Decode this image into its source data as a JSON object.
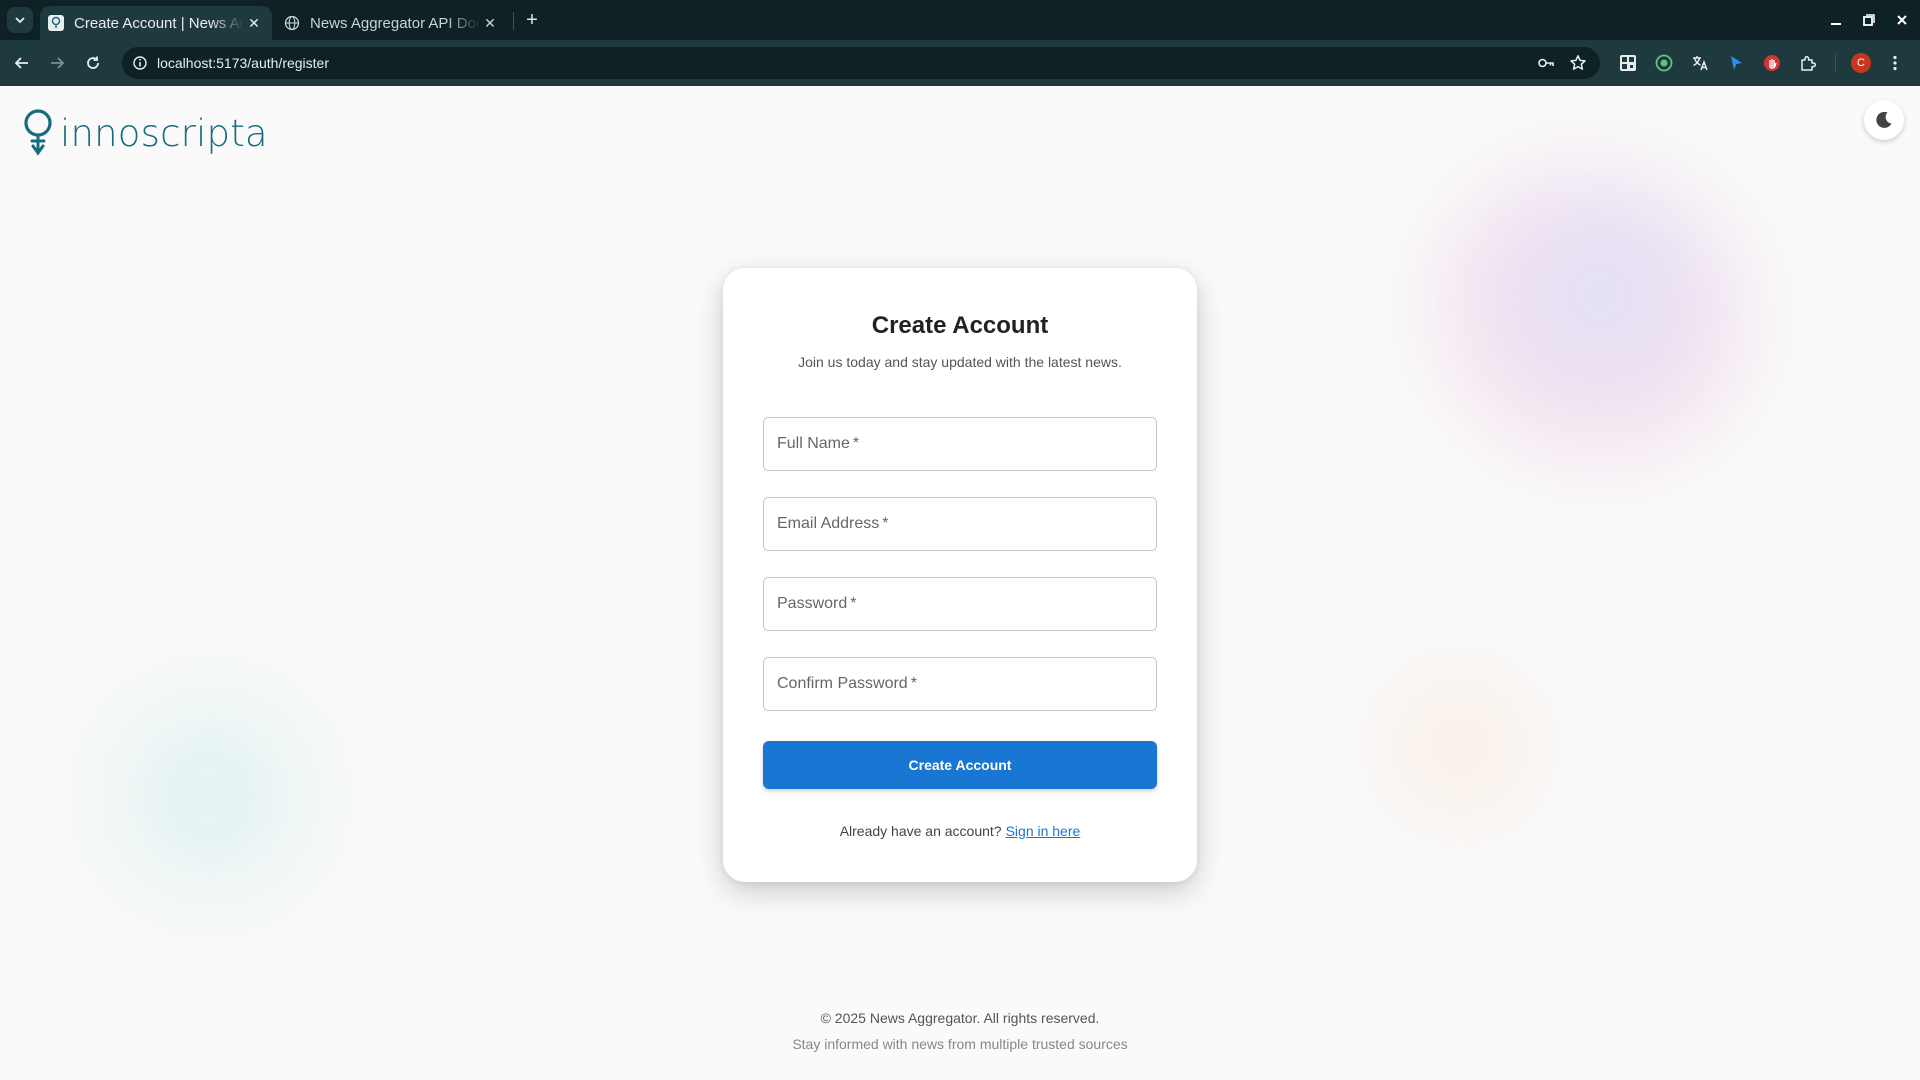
{
  "browser": {
    "tabs": [
      {
        "title": "Create Account | News Aggregator",
        "active": true
      },
      {
        "title": "News Aggregator API Docs",
        "active": false
      }
    ],
    "url": "localhost:5173/auth/register",
    "profile_initial": "C"
  },
  "page": {
    "brand": "innoscripta",
    "card": {
      "title": "Create Account",
      "subtitle": "Join us today and stay updated with the latest news.",
      "fields": [
        {
          "label": "Full Name",
          "required_mark": "*"
        },
        {
          "label": "Email Address",
          "required_mark": "*"
        },
        {
          "label": "Password",
          "required_mark": "*"
        },
        {
          "label": "Confirm Password",
          "required_mark": "*"
        }
      ],
      "submit_label": "Create Account",
      "signin_prompt": "Already have an account?",
      "signin_link": "Sign in here"
    },
    "footer": {
      "copyright": "© 2025 News Aggregator. All rights reserved.",
      "tagline": "Stay informed with news from multiple trusted sources"
    }
  },
  "colors": {
    "brand": "#176b80",
    "primary": "#1976d2",
    "chrome_dark": "#0e2226",
    "chrome_toolbar": "#1f3a3f"
  }
}
